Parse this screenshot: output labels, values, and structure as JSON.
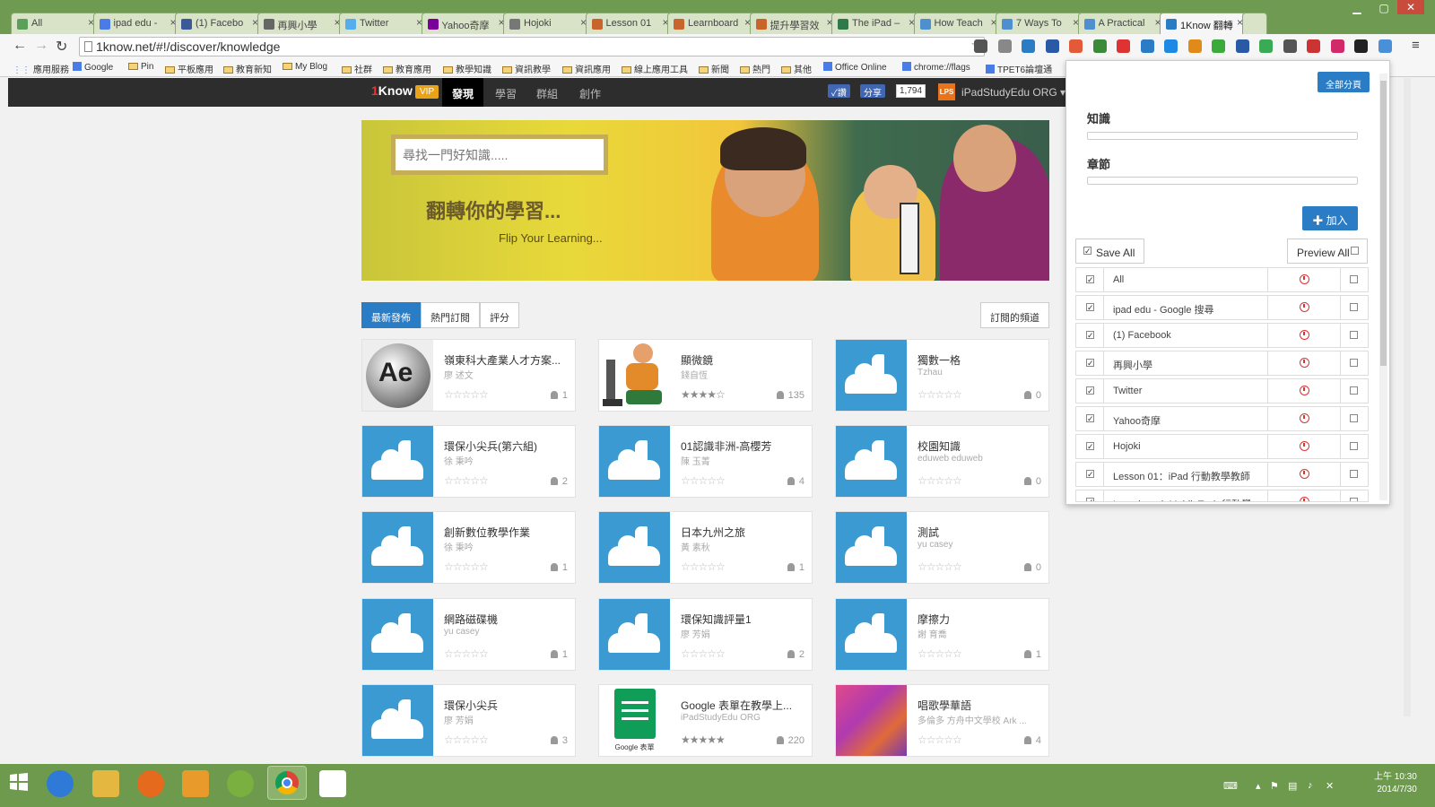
{
  "browser": {
    "tabs": [
      {
        "label": "All",
        "icon_color": "#5aa05a"
      },
      {
        "label": "ipad edu -",
        "icon_color": "#4a7ce8"
      },
      {
        "label": "(1) Facebo",
        "icon_color": "#3b5998"
      },
      {
        "label": "再興小學",
        "icon_color": "#666666"
      },
      {
        "label": "Twitter",
        "icon_color": "#55acee"
      },
      {
        "label": "Yahoo奇摩",
        "icon_color": "#7b0099"
      },
      {
        "label": "Hojoki",
        "icon_color": "#777777"
      },
      {
        "label": "Lesson 01",
        "icon_color": "#c9642b"
      },
      {
        "label": "Learnboard",
        "icon_color": "#c9642b"
      },
      {
        "label": "提升學習效",
        "icon_color": "#c9642b"
      },
      {
        "label": "The iPad –",
        "icon_color": "#2f7a4a"
      },
      {
        "label": "How Teach",
        "icon_color": "#4d8fcf"
      },
      {
        "label": "7 Ways To",
        "icon_color": "#4d8fcf"
      },
      {
        "label": "A Practical",
        "icon_color": "#4d8fcf"
      },
      {
        "label": "1Know 翻轉",
        "icon_color": "#2a7cc5",
        "active": true
      }
    ],
    "url": "1know.net/#!/discover/knowledge",
    "bookmarks": [
      {
        "label": "應用服務",
        "type": "apps"
      },
      {
        "label": "Google",
        "type": "site"
      },
      {
        "label": "Pin",
        "type": "folder"
      },
      {
        "label": "平板應用",
        "type": "folder"
      },
      {
        "label": "教育新知",
        "type": "folder"
      },
      {
        "label": "My Blog",
        "type": "folder"
      },
      {
        "label": "社群",
        "type": "folder"
      },
      {
        "label": "教育應用",
        "type": "folder"
      },
      {
        "label": "教學知識",
        "type": "folder"
      },
      {
        "label": "資訊教學",
        "type": "folder"
      },
      {
        "label": "資訊應用",
        "type": "folder"
      },
      {
        "label": "線上應用工具",
        "type": "folder"
      },
      {
        "label": "新聞",
        "type": "folder"
      },
      {
        "label": "熱門",
        "type": "folder"
      },
      {
        "label": "其他",
        "type": "folder"
      },
      {
        "label": "Office Online",
        "type": "site"
      },
      {
        "label": "chrome://flags",
        "type": "site"
      },
      {
        "label": "TPET6論壇通",
        "type": "site"
      }
    ]
  },
  "site": {
    "logo_prefix": "1",
    "logo_text": "Know",
    "vip": "VIP",
    "nav": [
      "發現",
      "學習",
      "群組",
      "創作"
    ],
    "nav_selected": 0,
    "fb_like": "✓讚",
    "fb_share": "分享",
    "fb_count": "1,794",
    "org_avatar": "LPS",
    "org_name": "iPadStudyEdu ORG ▾"
  },
  "hero": {
    "search_placeholder": "尋找一門好知識.....",
    "title": "翻轉你的學習...",
    "subtitle": "Flip Your Learning..."
  },
  "filters": {
    "tabs": [
      "最新發佈",
      "熱門訂閱",
      "評分"
    ],
    "selected": 0,
    "subscribed": "訂閱的頻道"
  },
  "cards": [
    {
      "title": "嶺東科大產業人才方案...",
      "author": "廖 述文",
      "stars": "☆☆☆☆☆",
      "count": "1",
      "thumb": "ae"
    },
    {
      "title": "顯微鏡",
      "author": "錢自恆",
      "stars": "★★★★☆",
      "count": "135",
      "thumb": "microscope"
    },
    {
      "title": "獨數一格",
      "author": "Tzhau",
      "stars": "☆☆☆☆☆",
      "count": "0",
      "thumb": "cloud"
    },
    {
      "title": "環保小尖兵(第六組)",
      "author": "徐 秉吟",
      "stars": "☆☆☆☆☆",
      "count": "2",
      "thumb": "cloud"
    },
    {
      "title": "01認識非洲-高櫻芳",
      "author": "陳 玉菁",
      "stars": "☆☆☆☆☆",
      "count": "4",
      "thumb": "cloud"
    },
    {
      "title": "校園知識",
      "author": "eduweb eduweb",
      "stars": "☆☆☆☆☆",
      "count": "0",
      "thumb": "cloud"
    },
    {
      "title": "創新數位教學作業",
      "author": "徐 秉吟",
      "stars": "☆☆☆☆☆",
      "count": "1",
      "thumb": "cloud"
    },
    {
      "title": "日本九州之旅",
      "author": "黃 素秋",
      "stars": "☆☆☆☆☆",
      "count": "1",
      "thumb": "cloud"
    },
    {
      "title": "測試",
      "author": "yu casey",
      "stars": "☆☆☆☆☆",
      "count": "0",
      "thumb": "cloud"
    },
    {
      "title": "網路磁碟機",
      "author": "yu casey",
      "stars": "☆☆☆☆☆",
      "count": "1",
      "thumb": "cloud"
    },
    {
      "title": "環保知識評量1",
      "author": "廖 芳娟",
      "stars": "☆☆☆☆☆",
      "count": "2",
      "thumb": "cloud"
    },
    {
      "title": "摩擦力",
      "author": "謝 育喬",
      "stars": "☆☆☆☆☆",
      "count": "1",
      "thumb": "cloud"
    },
    {
      "title": "環保小尖兵",
      "author": "廖 芳娟",
      "stars": "☆☆☆☆☆",
      "count": "3",
      "thumb": "cloud"
    },
    {
      "title": "Google 表單在教學上...",
      "author": "iPadStudyEdu ORG",
      "stars": "★★★★★",
      "count": "220",
      "thumb": "forms",
      "thumb_caption": "Google 表單"
    },
    {
      "title": "唱歌學華語",
      "author": "多倫多 方舟中文學校 Ark ...",
      "stars": "☆☆☆☆☆",
      "count": "4",
      "thumb": "kids"
    }
  ],
  "panel": {
    "share_all": "全部分頁",
    "knowledge_label": "知識",
    "chapter_label": "章節",
    "add_button": "✚ 加入",
    "save_all": "Save All",
    "preview_all": "Preview All",
    "rows": [
      "All",
      "ipad edu - Google 搜尋",
      "(1) Facebook",
      "再興小學",
      "Twitter",
      "Yahoo奇摩",
      "Hojoki",
      "Lesson 01：iPad 行動教學教師",
      "Learnboard: MobileTech 行動學"
    ]
  },
  "taskbar": {
    "time": "上午 10:30",
    "date": "2014/7/30"
  },
  "colors": {
    "accent": "#2a7cc5",
    "frame": "#6f9a52",
    "header": "#2d2d2d",
    "vip": "#e8a317",
    "remove": "#dd3333"
  }
}
